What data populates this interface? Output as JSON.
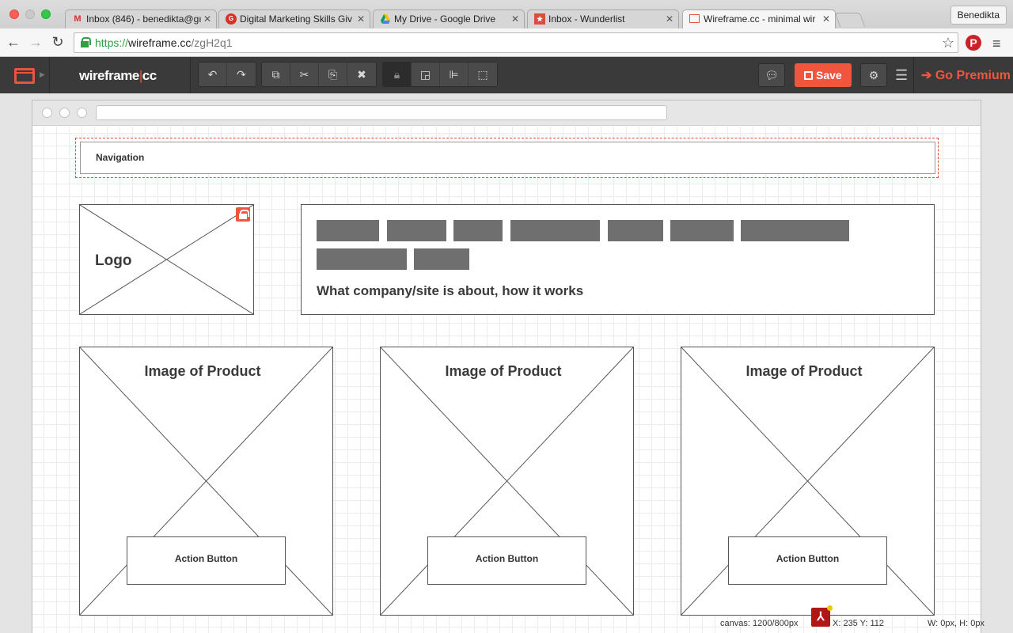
{
  "browser": {
    "tabs": [
      {
        "title": "Inbox (846) - benedikta@gı",
        "favicon": "gmail-icon",
        "active": false
      },
      {
        "title": "Digital Marketing Skills Giv",
        "favicon": "digital-marketing-icon",
        "active": false
      },
      {
        "title": "My Drive - Google Drive",
        "favicon": "google-drive-icon",
        "active": false
      },
      {
        "title": "Inbox - Wunderlist",
        "favicon": "wunderlist-icon",
        "active": false
      },
      {
        "title": "Wireframe.cc - minimal wir",
        "favicon": "wireframe-icon",
        "active": true
      }
    ],
    "profile_name": "Benedikta",
    "url_protocol": "https://",
    "url_host": "wireframe.cc",
    "url_path": "/zgH2q1"
  },
  "app": {
    "brand_left": "wireframe",
    "brand_sep": "|",
    "brand_right": "cc",
    "save_label": "Save",
    "premium_label": "Go Premium",
    "accent_color": "#f0553d"
  },
  "wireframe": {
    "navigation_label": "Navigation",
    "logo_label": "Logo",
    "about_text": "What company/site is about, how it works",
    "products": [
      {
        "title": "Image of Product",
        "button": "Action Button"
      },
      {
        "title": "Image of Product",
        "button": "Action Button"
      },
      {
        "title": "Image of Product",
        "button": "Action Button"
      }
    ]
  },
  "status": {
    "canvas": "canvas: 1200/800px",
    "coords": "X: 235 Y: 112",
    "size": "W: 0px, H: 0px"
  }
}
